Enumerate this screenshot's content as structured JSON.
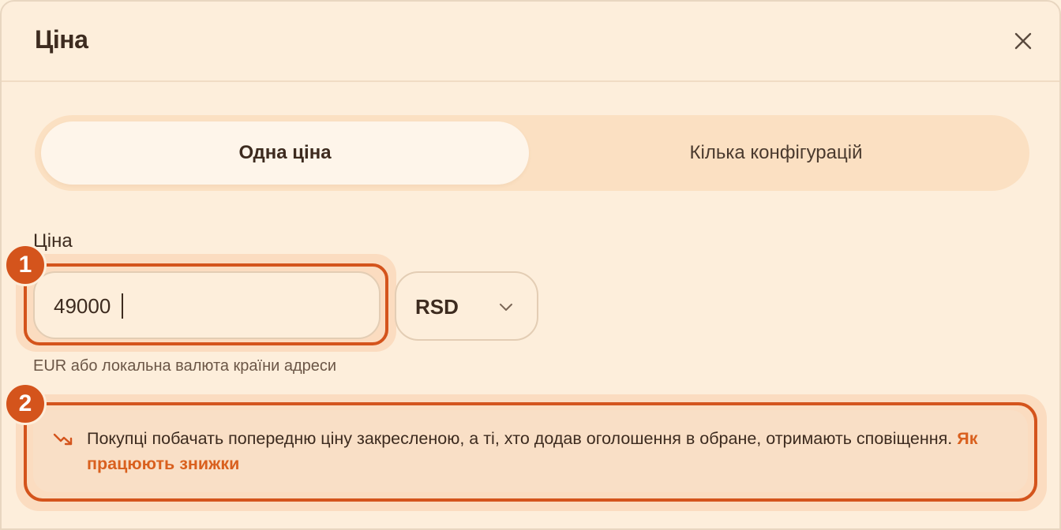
{
  "modal": {
    "title": "Ціна",
    "close_icon": "close-icon"
  },
  "segment": {
    "options": [
      {
        "label": "Одна ціна",
        "active": true
      },
      {
        "label": "Кілька конфігурацій",
        "active": false
      }
    ]
  },
  "price": {
    "label": "Ціна",
    "value": "49000",
    "currency": "RSD",
    "currency_icon": "chevron-down-icon",
    "hint": "EUR або локальна валюта країни адреси"
  },
  "notice": {
    "icon": "trend-down-icon",
    "text": "Покупці побачать попередню ціну закресленою, а ті, хто додав оголошення в обране, отримають сповіщення.",
    "link": "Як працюють знижки"
  },
  "badges": [
    "1",
    "2"
  ],
  "colors": {
    "background": "#fdeedb",
    "accent": "#d4541c",
    "link": "#d9601e",
    "segment_bg": "#fbe0c2"
  }
}
